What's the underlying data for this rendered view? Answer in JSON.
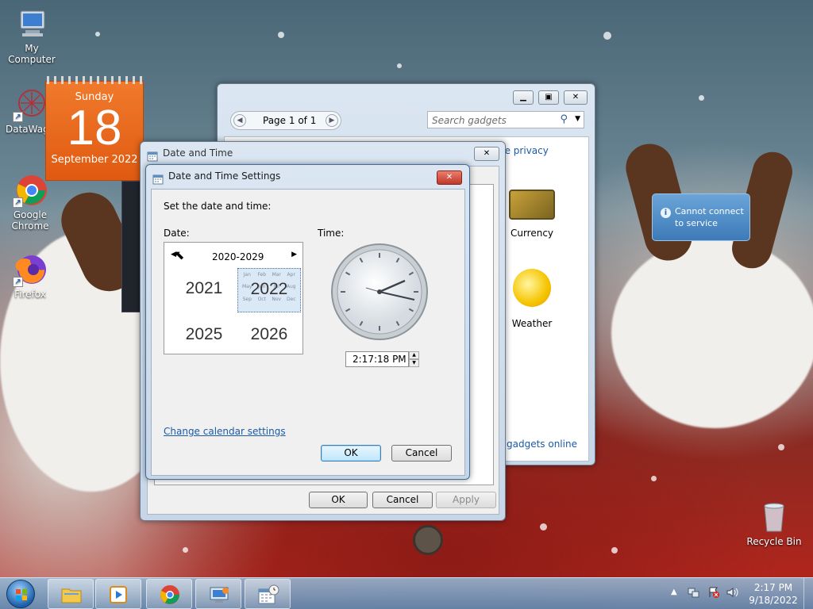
{
  "desktop": {
    "icons": [
      {
        "label": "My Computer",
        "icon": "computer-icon"
      },
      {
        "label": "DataWago",
        "icon": "datawagon-icon"
      },
      {
        "label": "Google Chrome",
        "icon": "chrome-icon"
      },
      {
        "label": "Firefox",
        "icon": "firefox-icon"
      },
      {
        "label": "Recycle Bin",
        "icon": "recycle-bin-icon"
      }
    ]
  },
  "calendar_gadget": {
    "weekday": "Sunday",
    "day": "18",
    "month_year": "September 2022"
  },
  "gadget_gallery": {
    "page_label": "Page 1 of 1",
    "search_placeholder": "Search gadgets",
    "privacy_link": "ne privacy",
    "items": [
      {
        "label": "Currency"
      },
      {
        "label": "Weather"
      }
    ],
    "get_more_link": "gadgets online",
    "partial_text": "ne"
  },
  "weather_tooltip": {
    "line1": "Cannot connect",
    "line2": "to service"
  },
  "date_time_dialog": {
    "title": "Date and Time",
    "buttons": {
      "ok": "OK",
      "cancel": "Cancel",
      "apply": "Apply"
    }
  },
  "settings_dialog": {
    "title": "Date and Time Settings",
    "prompt": "Set the date and time:",
    "date_label": "Date:",
    "time_label": "Time:",
    "calendar": {
      "range": "2020-2029",
      "years": [
        "2021",
        "2022",
        "2025",
        "2026"
      ],
      "selected_year": "2022",
      "overlay_months": [
        "Jan",
        "Feb",
        "Mar",
        "Apr",
        "May",
        "Jun",
        "Jul",
        "Aug",
        "Sep",
        "Oct",
        "Nov",
        "Dec"
      ]
    },
    "time_value": "2:17:18 PM",
    "change_calendar_link": "Change calendar settings",
    "buttons": {
      "ok": "OK",
      "cancel": "Cancel"
    }
  },
  "taskbar": {
    "clock_time": "2:17 PM",
    "clock_date": "9/18/2022",
    "items": [
      {
        "icon": "start-orb-icon"
      },
      {
        "icon": "file-explorer-icon"
      },
      {
        "icon": "media-player-icon"
      },
      {
        "icon": "chrome-icon"
      },
      {
        "icon": "control-panel-icon"
      },
      {
        "icon": "date-time-icon"
      }
    ]
  }
}
